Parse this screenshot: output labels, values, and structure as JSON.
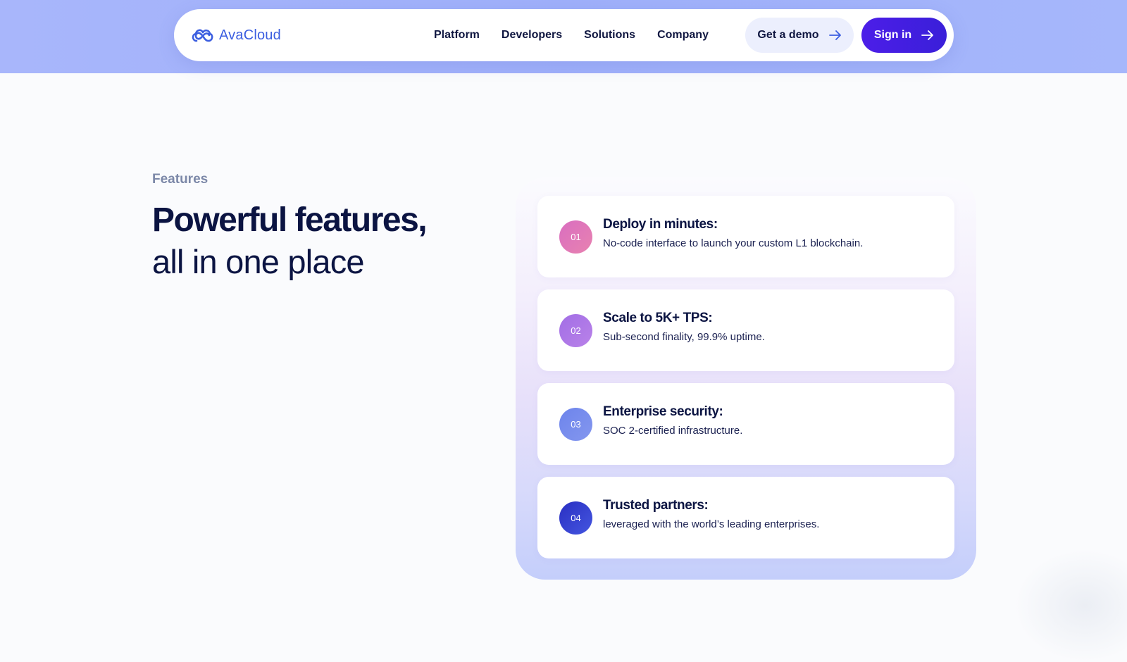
{
  "brand": {
    "name": "AvaCloud",
    "logo_icon": "cloud-infinity-icon",
    "logo_color": "#3b5ee0"
  },
  "nav": {
    "links": [
      "Platform",
      "Developers",
      "Solutions",
      "Company"
    ],
    "demo_label": "Get a demo",
    "signin_label": "Sign in",
    "arrow_icon": "arrow-right-icon"
  },
  "colors": {
    "top_band": "#a4b4fb",
    "signin_bg": "#4320e3",
    "demo_bg": "#eceffd",
    "text_dark": "#0b1442",
    "eyebrow": "#7c88a8"
  },
  "hero": {
    "eyebrow": "Features",
    "headline_strong": "Powerful features,",
    "headline_light": "all in one place"
  },
  "features": [
    {
      "number": "01",
      "title": "Deploy in minutes:",
      "description": "No-code interface to launch your custom L1 blockchain.",
      "color_from": "#d96ec0",
      "color_to": "#e882b0"
    },
    {
      "number": "02",
      "title": "Scale to 5K+ TPS:",
      "description": "Sub-second finality, 99.9% uptime.",
      "color_from": "#a26ee6",
      "color_to": "#b982e8"
    },
    {
      "number": "03",
      "title": "Enterprise security:",
      "description": "SOC 2-certified infrastructure.",
      "color_from": "#6d84ec",
      "color_to": "#8497ee"
    },
    {
      "number": "04",
      "title": "Trusted partners:",
      "description": "leveraged with the world’s leading enterprises.",
      "color_from": "#2a2fc2",
      "color_to": "#4456e0"
    }
  ]
}
